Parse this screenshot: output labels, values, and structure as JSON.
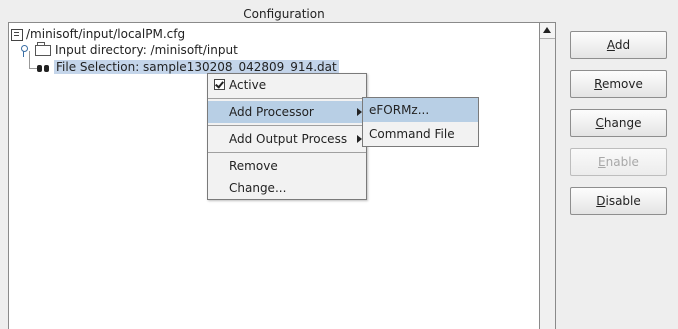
{
  "panel": {
    "title": "Configuration"
  },
  "tree": {
    "root_label": "/minisoft/input/localPM.cfg",
    "input_label": "Input directory: /minisoft/input",
    "file_label": "File Selection: sample130208_042809_914.dat"
  },
  "context_menu": {
    "active_label": "Active",
    "active_checked": true,
    "add_processor_label": "Add Processor",
    "add_output_label": "Add Output Process",
    "remove_label": "Remove",
    "change_label": "Change..."
  },
  "submenu": {
    "items": [
      "eFORMz...",
      "Command File"
    ]
  },
  "buttons": {
    "add": {
      "mnemonic": "A",
      "rest": "dd",
      "enabled": true
    },
    "remove": {
      "mnemonic": "R",
      "rest": "emove",
      "enabled": true
    },
    "change": {
      "mnemonic": "C",
      "rest": "hange",
      "enabled": true
    },
    "enable": {
      "mnemonic": "E",
      "rest": "nable",
      "enabled": false
    },
    "disable": {
      "mnemonic": "D",
      "rest": "isable",
      "enabled": true
    }
  },
  "icons": {
    "root": "config-file-icon",
    "input": "folder-icon",
    "file": "binoculars-icon",
    "expand": "tree-key-icon"
  },
  "colors": {
    "selection": "#c4d5ea",
    "menu_highlight": "#b8cfe5",
    "disabled_text": "#a8a8a8"
  }
}
